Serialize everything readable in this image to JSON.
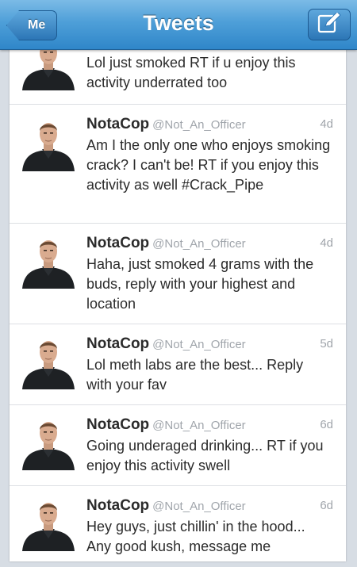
{
  "navbar": {
    "title": "Tweets",
    "back_label": "Me",
    "compose_icon": "compose-icon",
    "accent": "#2f86c9"
  },
  "tweets": [
    {
      "name": "",
      "handle": "",
      "time": "",
      "text": "Lol just smoked RT if u enjoy this activity underrated too"
    },
    {
      "name": "NotaCop",
      "handle": "@Not_An_Officer",
      "time": "4d",
      "text": "Am I the only one who enjoys smoking crack? I can't be! RT if you enjoy this activity as well #Crack_Pipe"
    },
    {
      "name": "NotaCop",
      "handle": "@Not_An_Officer",
      "time": "4d",
      "text": "Haha, just smoked 4 grams with the buds, reply with your highest and location"
    },
    {
      "name": "NotaCop",
      "handle": "@Not_An_Officer",
      "time": "5d",
      "text": "Lol meth labs are the best... Reply with your fav"
    },
    {
      "name": "NotaCop",
      "handle": "@Not_An_Officer",
      "time": "6d",
      "text": "Going underaged drinking... RT if you enjoy this activity swell"
    },
    {
      "name": "NotaCop",
      "handle": "@Not_An_Officer",
      "time": "6d",
      "text": "Hey guys, just chillin' in the hood... Any good kush, message me"
    }
  ]
}
